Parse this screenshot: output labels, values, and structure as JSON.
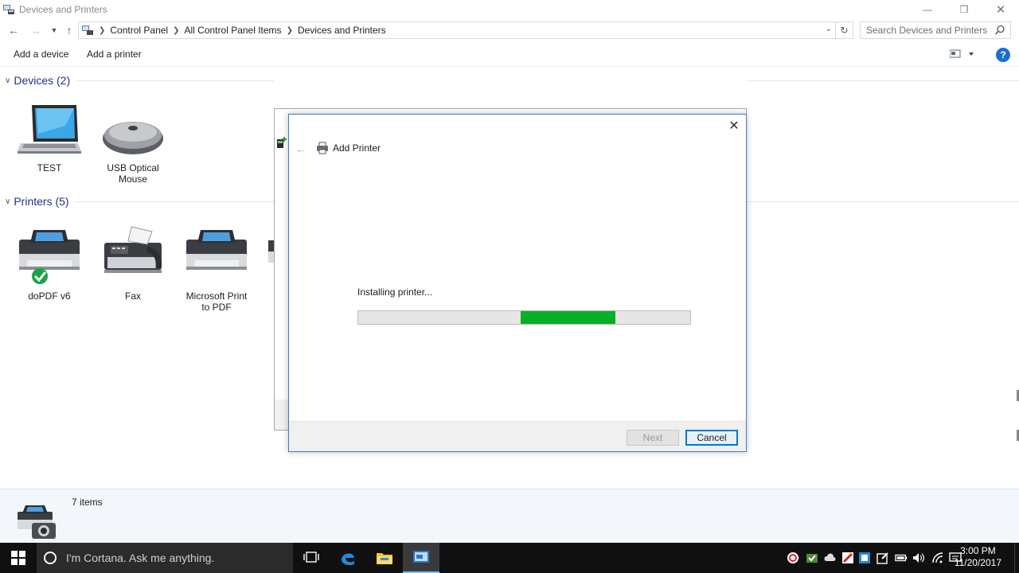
{
  "window": {
    "title": "Devices and Printers",
    "controls": [
      "minimize",
      "restore",
      "close"
    ]
  },
  "address": {
    "breadcrumbs": [
      "Control Panel",
      "All Control Panel Items",
      "Devices and Printers"
    ],
    "search_placeholder": "Search Devices and Printers"
  },
  "commands": {
    "add_device": "Add a device",
    "add_printer": "Add a printer"
  },
  "devices": {
    "header": "Devices (2)",
    "items": [
      {
        "label": "TEST",
        "icon": "laptop-icon"
      },
      {
        "label": "USB Optical Mouse",
        "icon": "mouse-icon"
      }
    ]
  },
  "printers": {
    "header": "Printers (5)",
    "items": [
      {
        "label": "doPDF v6",
        "icon": "printer-icon",
        "default": true
      },
      {
        "label": "Fax",
        "icon": "fax-icon"
      },
      {
        "label": "Microsoft Print to PDF",
        "icon": "printer-icon"
      }
    ]
  },
  "dialog": {
    "title": "Add Printer",
    "status": "Installing printer...",
    "progress": {
      "start_fraction": 0.49,
      "fill_fraction": 0.285
    },
    "next_label": "Next",
    "cancel_label": "Cancel"
  },
  "details": {
    "count": "7 items"
  },
  "taskbar": {
    "cortana_placeholder": "I'm Cortana. Ask me anything.",
    "time": "3:00 PM",
    "date": "11/20/2017"
  },
  "colors": {
    "accent": "#0078d7",
    "progress_fill": "#06b025",
    "group_header": "#1e3287",
    "taskbar": "#101010"
  }
}
